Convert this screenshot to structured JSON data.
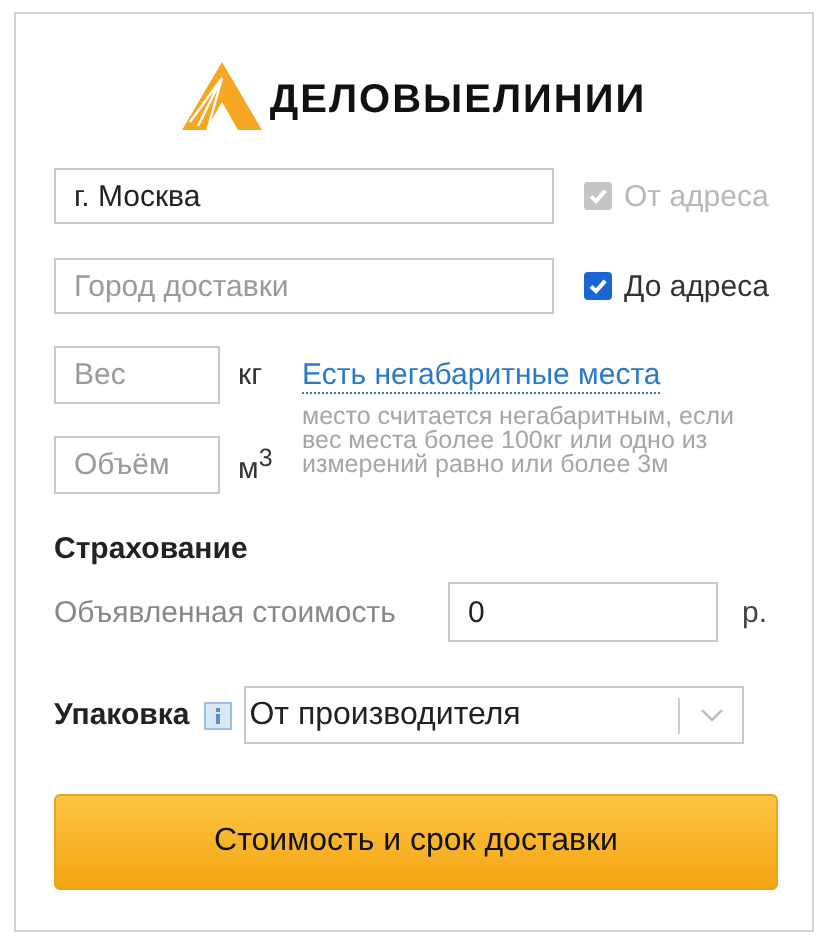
{
  "logo": {
    "text": "ДЕЛОВЫЕЛИНИИ"
  },
  "route": [
    {
      "value": "г. Москва",
      "option": "От адреса",
      "checked": true,
      "disabled": true
    },
    {
      "placeholder": "Город доставки",
      "option": "До адреса",
      "checked": true,
      "disabled": false
    }
  ],
  "cargo": {
    "weight": {
      "placeholder": "Вес",
      "unit": "кг"
    },
    "volume": {
      "placeholder": "Объём",
      "unit": "м$^{3}$"
    },
    "oversize_link": "Есть негабаритные места",
    "oversize_hint": "место считается негабаритным, если вес места более 100кг или одно из измерений равно или более 3м"
  },
  "insurance": {
    "heading": "Страхование",
    "label": "Объявленная стоимость",
    "value": "0",
    "currency": "р."
  },
  "packaging": {
    "label": "Упаковка",
    "value": "От производителя"
  },
  "submit": "Стоимость и срок доставки"
}
